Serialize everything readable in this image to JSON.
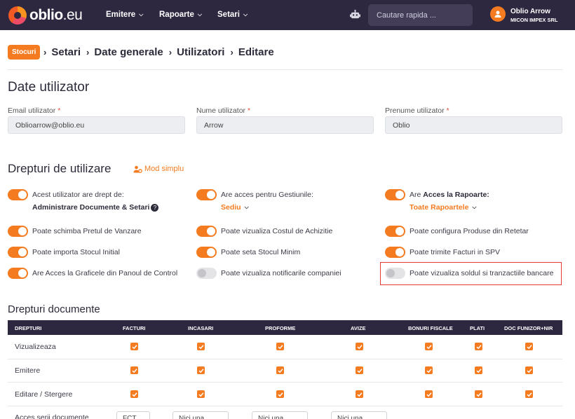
{
  "header": {
    "logo": {
      "main": "oblio",
      "suffix": ".eu"
    },
    "nav": [
      {
        "label": "Emitere"
      },
      {
        "label": "Rapoarte"
      },
      {
        "label": "Setari"
      }
    ],
    "search_placeholder": "Cautare rapida ...",
    "user": {
      "name": "Oblio Arrow",
      "company": "MICON IMPEX SRL"
    }
  },
  "breadcrumb": {
    "badge": "Stocuri",
    "items": [
      "Setari",
      "Date generale",
      "Utilizatori",
      "Editare"
    ],
    "separator": "›"
  },
  "user_data": {
    "title": "Date utilizator",
    "fields": [
      {
        "label": "Email utilizator",
        "value": "Oblioarrow@oblio.eu"
      },
      {
        "label": "Nume utilizator",
        "value": "Arrow"
      },
      {
        "label": "Prenume utilizator",
        "value": "Oblio"
      }
    ],
    "required_mark": "*"
  },
  "rights": {
    "title": "Drepturi de utilizare",
    "mode_link": "Mod simplu",
    "items": [
      {
        "text": "Acest utilizator are drept de:",
        "bold": "Administrare Documente & Setari",
        "on": true
      },
      {
        "text": "Are acces pentru Gestiunile:",
        "select": "Sediu",
        "on": true
      },
      {
        "text_prefix": "Are ",
        "bold": "Acces la Rapoarte:",
        "select": "Toate Rapoartele",
        "on": true
      },
      {
        "text": "Poate schimba Pretul de Vanzare",
        "on": true
      },
      {
        "text": "Poate vizualiza Costul de Achizitie",
        "on": true
      },
      {
        "text": "Poate configura Produse din Retetar",
        "on": true
      },
      {
        "text": "Poate importa Stocul Initial",
        "on": true
      },
      {
        "text": "Poate seta Stocul Minim",
        "on": true
      },
      {
        "text": "Poate trimite Facturi in SPV",
        "on": true
      },
      {
        "text": "Are Acces la Graficele din Panoul de Control",
        "on": true
      },
      {
        "text": "Poate vizualiza notificarile companiei",
        "on": false
      },
      {
        "text": "Poate vizualiza soldul si tranzactiile bancare",
        "on": false
      }
    ]
  },
  "documents": {
    "title": "Drepturi documente",
    "columns": [
      "DREPTURI",
      "FACTURI",
      "INCASARI",
      "PROFORME",
      "AVIZE",
      "BONURI FISCALE",
      "PLATI",
      "DOC FUNIZOR+NIR"
    ],
    "rows": [
      {
        "label": "Vizualizeaza",
        "checked": [
          true,
          true,
          true,
          true,
          true,
          true,
          true
        ]
      },
      {
        "label": "Emitere",
        "checked": [
          true,
          true,
          true,
          true,
          true,
          true,
          true
        ]
      },
      {
        "label": "Editare / Stergere",
        "checked": [
          true,
          true,
          true,
          true,
          true,
          true,
          true
        ]
      }
    ],
    "series_row": {
      "label": "Acces serii documente",
      "values": [
        "FCT",
        "Nici una",
        "Nici una",
        "Nici una"
      ]
    }
  },
  "colors": {
    "accent": "#f47b20",
    "topbar": "#2d2740",
    "highlight_border": "#e53935"
  }
}
